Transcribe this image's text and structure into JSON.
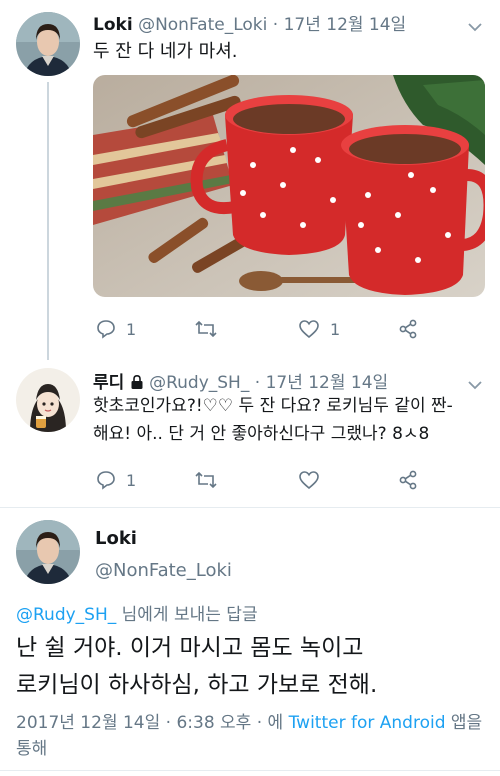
{
  "tweet1": {
    "name": "Loki",
    "handle": "@NonFate_Loki",
    "dot": "·",
    "date": "17년 12월 14일",
    "text": "두 잔 다 네가 마셔.",
    "reply_count": "1",
    "retweet_count": "",
    "like_count": "1"
  },
  "tweet2": {
    "name": "루디",
    "handle": "@Rudy_SH_",
    "dot": "·",
    "date": "17년 12월 14일",
    "text_line1": "핫초코인가요?!♡♡ 두 잔 다요? 로키님두 같이 짠-",
    "text_line2": "해요! 아.. 단 거 안 좋아하신다구 그랬나? 8ㅅ8",
    "reply_count": "1",
    "retweet_count": "",
    "like_count": ""
  },
  "focus": {
    "name": "Loki",
    "handle": "@NonFate_Loki",
    "reply_mention": "@Rudy_SH_",
    "reply_suffix": " 님에게 보내는 답글",
    "text_line1": "난 쉴 거야. 이거 마시고 몸도 녹이고",
    "text_line2": "로키님이 하사하심, 하고 가보로 전해.",
    "meta_date": "2017년 12월 14일 · 6:38 오후 · 에 ",
    "meta_app": "Twitter for Android",
    "meta_suffix": " 앱을",
    "meta_line2": "통해"
  },
  "icons": {
    "reply": "reply-icon",
    "retweet": "retweet-icon",
    "like": "heart-icon",
    "share": "share-icon",
    "lock": "lock-icon",
    "chevron": "chevron-down-icon"
  },
  "colors": {
    "text": "#14171a",
    "secondary": "#657786",
    "link": "#1da1f2",
    "divider": "#e6ecf0"
  }
}
